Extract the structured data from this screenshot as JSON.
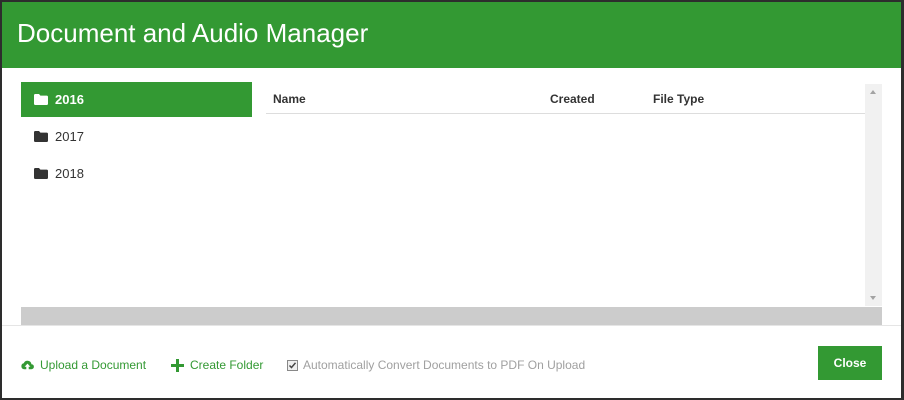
{
  "modal": {
    "title": "Document and Audio Manager",
    "accent_color": "#339933"
  },
  "folders": [
    {
      "label": "2016",
      "icon": "folder-icon",
      "selected": true
    },
    {
      "label": "2017",
      "icon": "folder-icon",
      "selected": false
    },
    {
      "label": "2018",
      "icon": "folder-icon",
      "selected": false
    }
  ],
  "file_table": {
    "columns": [
      "Name",
      "Created",
      "File Type"
    ],
    "rows": []
  },
  "footer": {
    "upload_label": "Upload a Document",
    "upload_icon": "cloud-upload-icon",
    "create_folder_label": "Create Folder",
    "create_folder_icon": "plus-icon",
    "convert_label": "Automatically Convert Documents to PDF On Upload",
    "convert_checked": true,
    "close_label": "Close"
  }
}
